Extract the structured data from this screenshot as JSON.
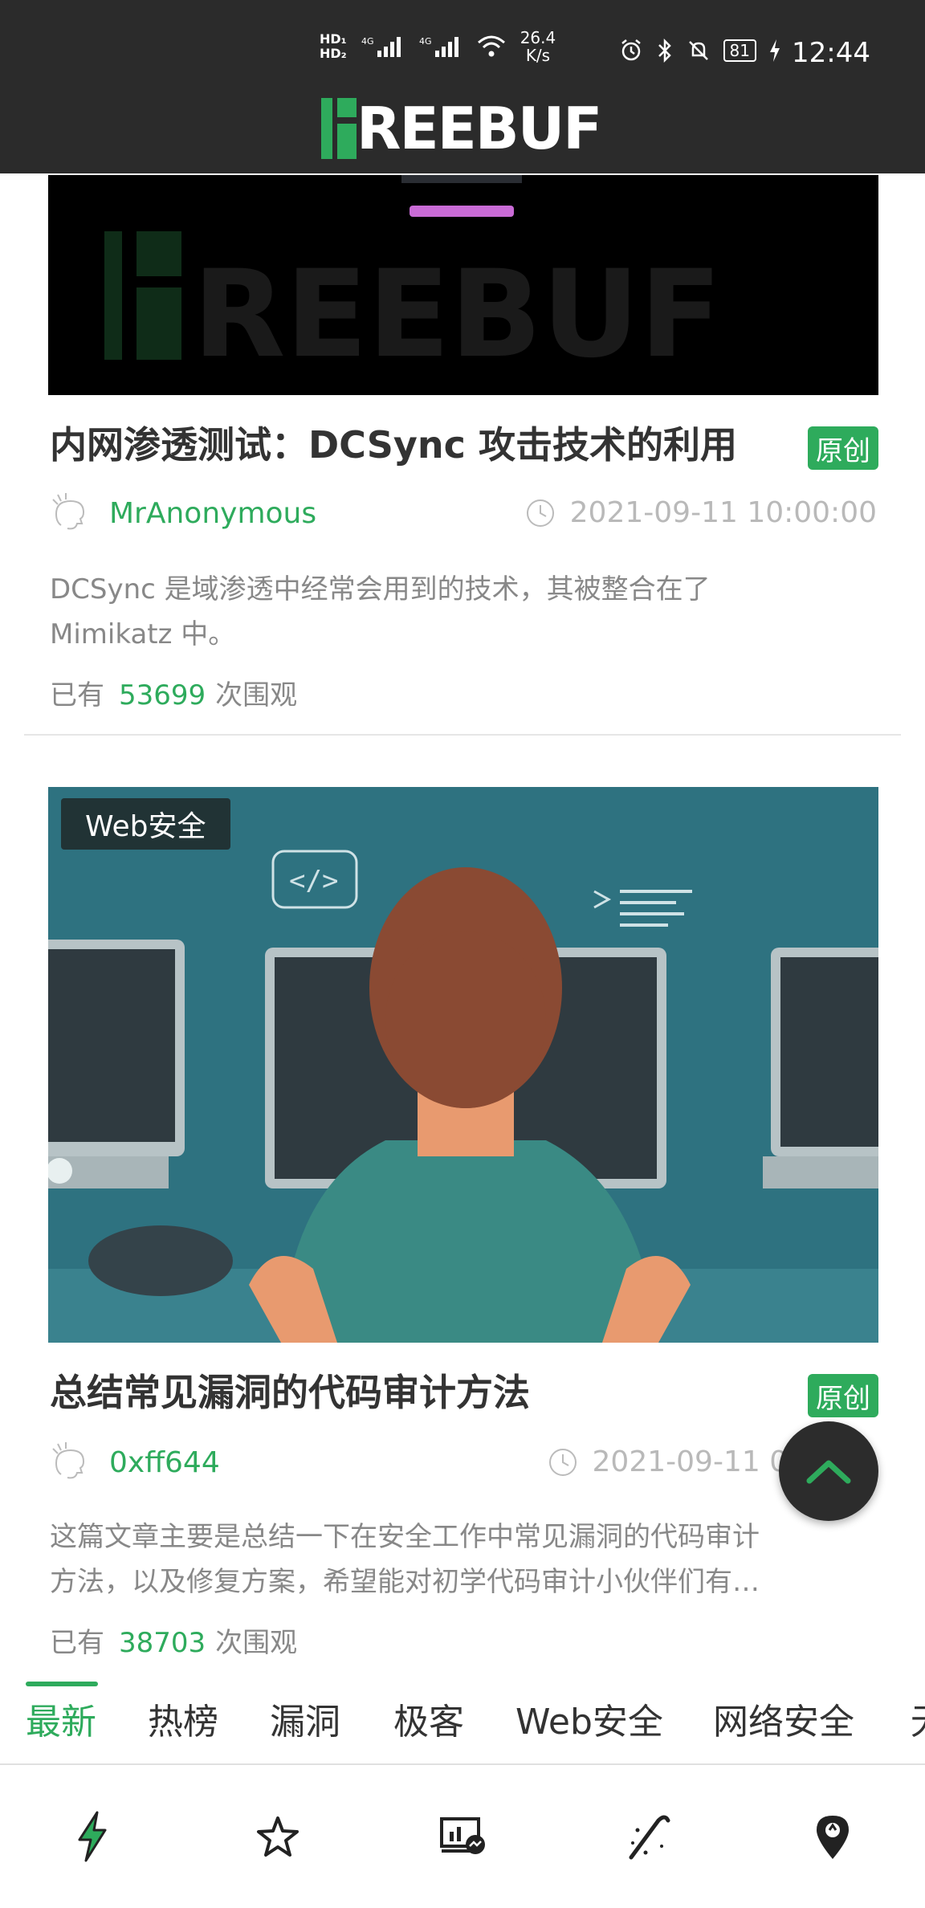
{
  "status_bar": {
    "network_speed_value": "26.4",
    "network_speed_unit": "K/s",
    "battery": "81",
    "time": "12:44"
  },
  "header": {
    "logo_text": "REEBUF"
  },
  "articles": [
    {
      "title": "内网渗透测试：DCSync 攻击技术的利用",
      "badge": "原创",
      "author": "MrAnonymous",
      "date": "2021-09-11 10:00:00",
      "excerpt_line1": "DCSync 是域渗透中经常会用到的技术，其被整合在了",
      "excerpt_line2": "Mimikatz 中。",
      "views_prefix": "已有",
      "views_count": "53699",
      "views_suffix": "次围观"
    },
    {
      "category": "Web安全",
      "title": "总结常见漏洞的代码审计方法",
      "badge": "原创",
      "author": "0xff644",
      "date": "2021-09-11 08",
      "excerpt_line1": "这篇文章主要是总结一下在安全工作中常见漏洞的代码审计",
      "excerpt_line2": "方法，以及修复方案，希望能对初学代码审计小伙伴们有…",
      "views_prefix": "已有",
      "views_count": "38703",
      "views_suffix": "次围观"
    }
  ],
  "tabs": [
    "最新",
    "热榜",
    "漏洞",
    "极客",
    "Web安全",
    "网络安全",
    "无"
  ],
  "bottom_nav": [
    "lightning-icon",
    "star-icon",
    "monitor-chart-icon",
    "wand-icon",
    "location-pin-icon"
  ],
  "colors": {
    "accent": "#2eab5c",
    "header_bg": "#2b2b2b"
  }
}
